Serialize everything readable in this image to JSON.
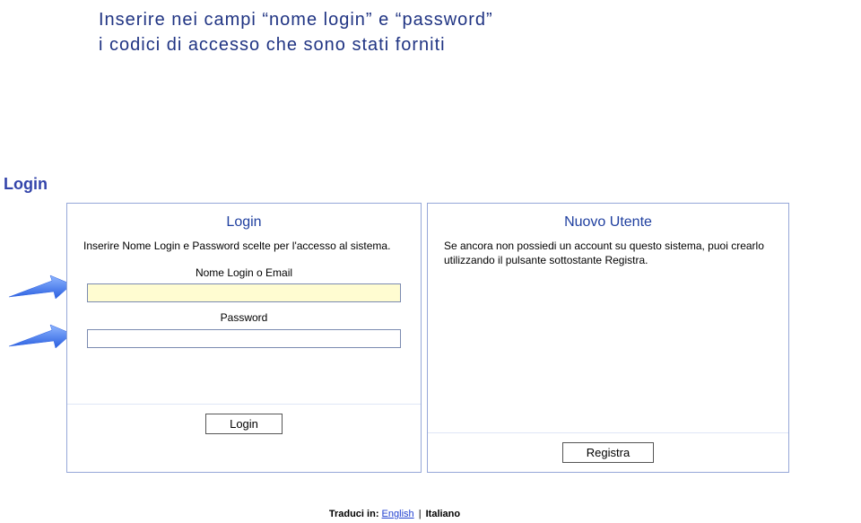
{
  "instruction": {
    "line1": "Inserire nei campi “nome login” e “password”",
    "line2": "i codici di accesso che sono stati forniti"
  },
  "section_title": "Login",
  "login_panel": {
    "title": "Login",
    "description": "Inserire Nome Login e Password scelte per l'accesso al sistema.",
    "login_label": "Nome Login o Email",
    "login_value": "",
    "password_label": "Password",
    "password_value": "",
    "button": "Login"
  },
  "new_user_panel": {
    "title": "Nuovo Utente",
    "description": "Se ancora non possiedi un account su questo sistema, puoi crearlo utilizzando il pulsante sottostante Registra.",
    "button": "Registra"
  },
  "translate": {
    "label": "Traduci in:",
    "english": "English",
    "italian": "Italiano"
  }
}
